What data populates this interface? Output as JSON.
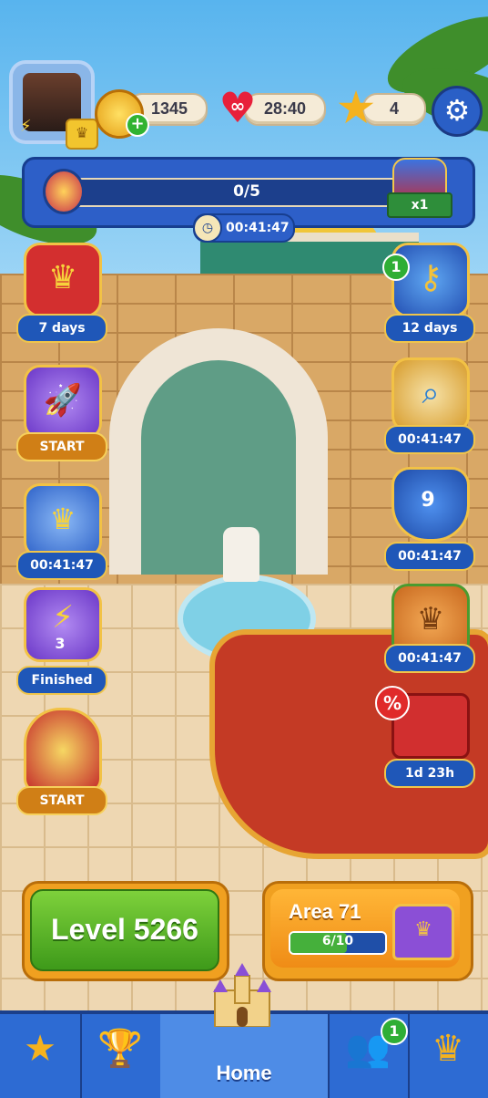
{
  "hud": {
    "coins": "1345",
    "lives_symbol": "∞",
    "lives_timer": "28:40",
    "stars": "4"
  },
  "progress": {
    "text": "0/5",
    "value": 0,
    "max": 5,
    "multiplier": "x1",
    "timer": "00:41:47"
  },
  "left_events": [
    {
      "name": "crown-book",
      "label": "7 days"
    },
    {
      "name": "rocket",
      "label": "START"
    },
    {
      "name": "anvil",
      "label": "00:41:47"
    },
    {
      "name": "lightning",
      "count": "3",
      "label": "Finished"
    },
    {
      "name": "crown-helmet",
      "label": "START"
    }
  ],
  "right_events": [
    {
      "name": "key",
      "badge": "1",
      "label": "12 days"
    },
    {
      "name": "magnifier-scroll",
      "label": "00:41:47"
    },
    {
      "name": "shield",
      "count": "9",
      "label": "00:41:47"
    },
    {
      "name": "crown-chest",
      "label": "00:41:47"
    },
    {
      "name": "bus-offer",
      "badge": "%",
      "label": "1d 23h"
    }
  ],
  "level_button": {
    "label": "Level 5266"
  },
  "area_button": {
    "title": "Area 71",
    "progress_text": "6/10",
    "progress_value": 6,
    "progress_max": 10
  },
  "nav": {
    "home_label": "Home",
    "team_badge": "1",
    "items": [
      "star-book",
      "trophy",
      "home",
      "team",
      "cards"
    ]
  },
  "colors": {
    "accent_blue": "#2d6bd3",
    "level_green": "#5bb52b",
    "area_orange": "#f39a1c",
    "label_blue": "#1f57b8"
  }
}
